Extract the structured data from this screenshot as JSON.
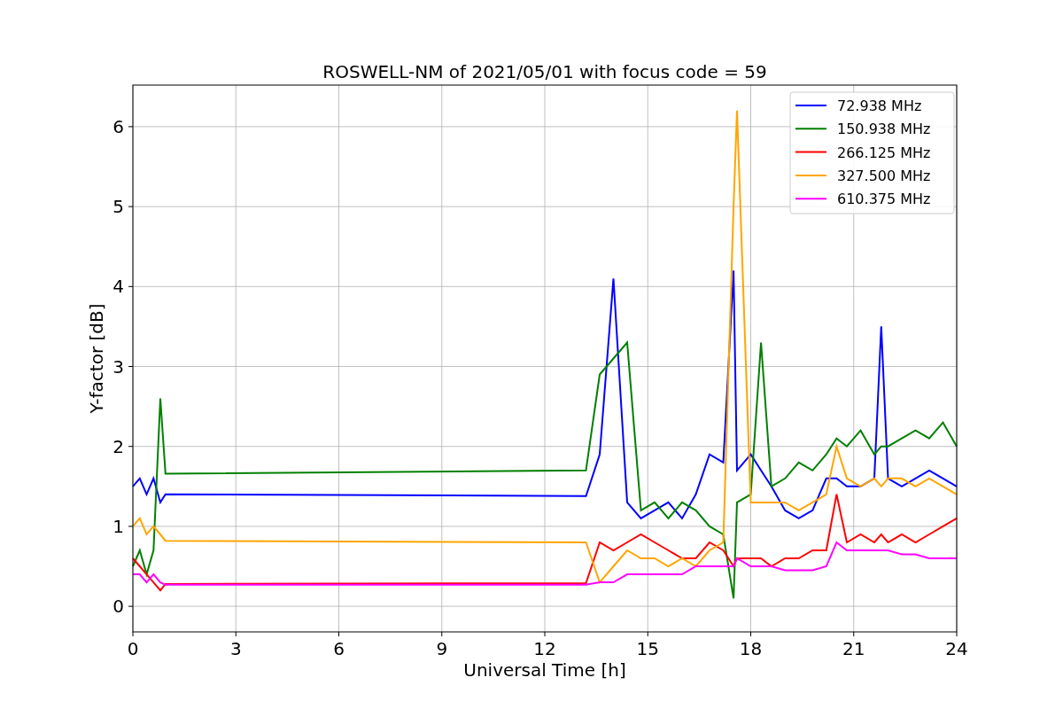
{
  "chart_data": {
    "type": "line",
    "title": "ROSWELL-NM of 2021/05/01 with focus code = 59",
    "xlabel": "Universal Time [h]",
    "ylabel": "Y-factor [dB]",
    "x": [
      0,
      0.2,
      0.4,
      0.6,
      0.8,
      0.95,
      13.2,
      13.6,
      14.0,
      14.4,
      14.8,
      15.2,
      15.6,
      16.0,
      16.4,
      16.8,
      17.2,
      17.5,
      17.6,
      18.0,
      18.3,
      18.6,
      19.0,
      19.4,
      19.8,
      20.2,
      20.5,
      20.8,
      21.2,
      21.6,
      21.8,
      22.0,
      22.4,
      22.8,
      23.2,
      23.6,
      24.0
    ],
    "series": [
      {
        "name": "72.938 MHz",
        "color": "#0000ff",
        "values": [
          1.5,
          1.6,
          1.4,
          1.6,
          1.3,
          1.4,
          1.38,
          1.9,
          4.1,
          1.3,
          1.1,
          1.2,
          1.3,
          1.1,
          1.4,
          1.9,
          1.8,
          4.2,
          1.7,
          1.9,
          1.7,
          1.5,
          1.2,
          1.1,
          1.2,
          1.6,
          1.6,
          1.5,
          1.5,
          1.6,
          3.5,
          1.6,
          1.5,
          1.6,
          1.7,
          1.6,
          1.5
        ]
      },
      {
        "name": "150.938 MHz",
        "color": "#008000",
        "values": [
          0.5,
          0.7,
          0.4,
          0.7,
          2.6,
          1.66,
          1.7,
          2.9,
          3.1,
          3.3,
          1.2,
          1.3,
          1.1,
          1.3,
          1.2,
          1.0,
          0.9,
          0.1,
          1.3,
          1.4,
          3.3,
          1.5,
          1.6,
          1.8,
          1.7,
          1.9,
          2.1,
          2.0,
          2.2,
          1.9,
          2.0,
          2.0,
          2.1,
          2.2,
          2.1,
          2.3,
          2.0
        ]
      },
      {
        "name": "266.125 MHz",
        "color": "#ff0000",
        "values": [
          0.6,
          0.5,
          0.4,
          0.3,
          0.2,
          0.28,
          0.29,
          0.8,
          0.7,
          0.8,
          0.9,
          0.8,
          0.7,
          0.6,
          0.6,
          0.8,
          0.7,
          0.5,
          0.6,
          0.6,
          0.6,
          0.5,
          0.6,
          0.6,
          0.7,
          0.7,
          1.4,
          0.8,
          0.9,
          0.8,
          0.9,
          0.8,
          0.9,
          0.8,
          0.9,
          1.0,
          1.1
        ]
      },
      {
        "name": "327.500 MHz",
        "color": "#ffa500",
        "values": [
          1.0,
          1.1,
          0.9,
          1.0,
          0.9,
          0.82,
          0.8,
          0.3,
          0.5,
          0.7,
          0.6,
          0.6,
          0.5,
          0.6,
          0.5,
          0.7,
          0.8,
          5.0,
          6.2,
          1.3,
          1.3,
          1.3,
          1.3,
          1.2,
          1.3,
          1.4,
          2.0,
          1.6,
          1.5,
          1.6,
          1.5,
          1.6,
          1.6,
          1.5,
          1.6,
          1.5,
          1.4
        ]
      },
      {
        "name": "610.375 MHz",
        "color": "#ff00ff",
        "values": [
          0.4,
          0.4,
          0.3,
          0.4,
          0.3,
          0.27,
          0.27,
          0.3,
          0.3,
          0.4,
          0.4,
          0.4,
          0.4,
          0.4,
          0.5,
          0.5,
          0.5,
          0.5,
          0.6,
          0.5,
          0.5,
          0.5,
          0.45,
          0.45,
          0.45,
          0.5,
          0.8,
          0.7,
          0.7,
          0.7,
          0.7,
          0.7,
          0.65,
          0.65,
          0.6,
          0.6,
          0.6
        ]
      }
    ],
    "xlim": [
      0,
      24
    ],
    "ylim": [
      -0.32,
      6.52
    ],
    "xticks": [
      0,
      3,
      6,
      9,
      12,
      15,
      18,
      21,
      24
    ],
    "yticks": [
      0,
      1,
      2,
      3,
      4,
      5,
      6
    ],
    "grid": true,
    "legend": true
  }
}
